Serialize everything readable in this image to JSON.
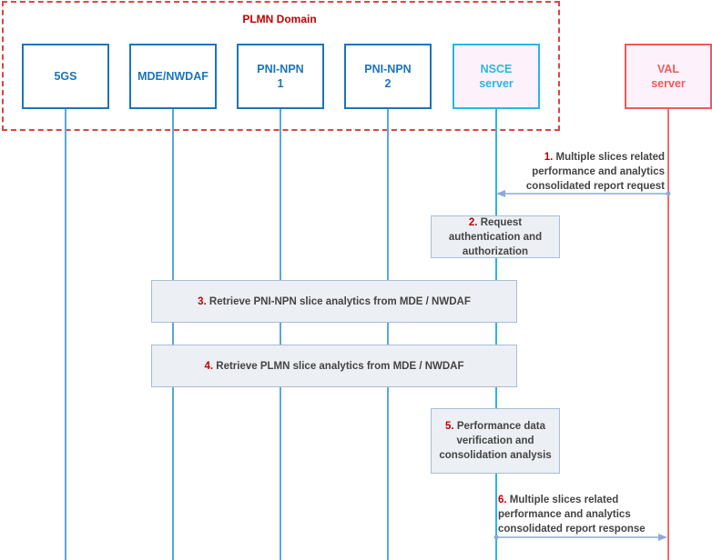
{
  "domain": {
    "label": "PLMN Domain"
  },
  "entities": [
    {
      "id": "5gs",
      "label": "5GS"
    },
    {
      "id": "mde-nwdaf",
      "label": "MDE/NWDAF"
    },
    {
      "id": "pni-npn-1",
      "label": "PNI-NPN\n1"
    },
    {
      "id": "pni-npn-2",
      "label": "PNI-NPN\n2"
    },
    {
      "id": "nsce-server",
      "label": "NSCE\nserver"
    },
    {
      "id": "val-server",
      "label": "VAL\nserver"
    }
  ],
  "steps": [
    {
      "num": "1.",
      "text": "Multiple slices related performance and analytics consolidated report request",
      "from": "val-server",
      "to": "nsce-server",
      "kind": "message"
    },
    {
      "num": "2.",
      "text": "Request authentication and authorization",
      "kind": "process"
    },
    {
      "num": "3.",
      "text": "Retrieve PNI-NPN slice analytics from MDE / NWDAF",
      "kind": "process"
    },
    {
      "num": "4.",
      "text": "Retrieve PLMN slice analytics from MDE / NWDAF",
      "kind": "process"
    },
    {
      "num": "5.",
      "text": "Performance data verification and consolidation analysis",
      "kind": "process"
    },
    {
      "num": "6.",
      "text": "Multiple slices related performance and analytics consolidated report response",
      "from": "nsce-server",
      "to": "val-server",
      "kind": "message"
    }
  ],
  "colors": {
    "domain_border": "#d9454a",
    "entity_blue": "#1b75bc",
    "nsce_cyan": "#29b6e8",
    "val_red": "#f05a5a",
    "step_number": "#c00000",
    "arrow": "#8eaad4"
  }
}
